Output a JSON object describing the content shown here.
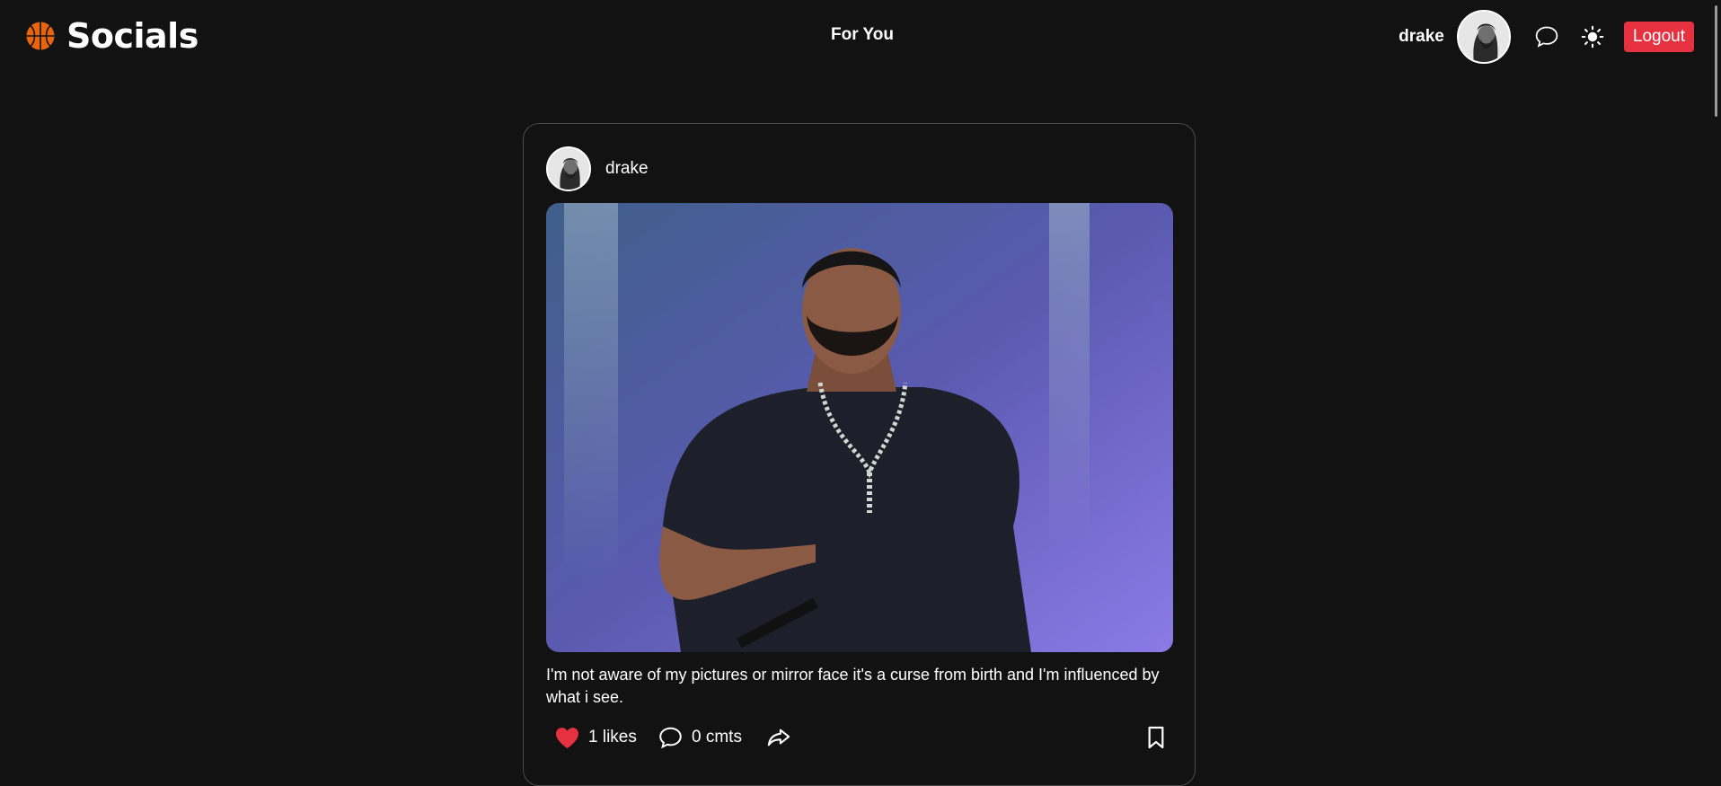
{
  "header": {
    "brand": "Socials",
    "nav_tab": "For You",
    "username": "drake",
    "logout_label": "Logout"
  },
  "post": {
    "username": "drake",
    "caption": "I'm not aware of my pictures or mirror face it's a curse from birth and I'm influenced by what i see.",
    "likes_label": "1 likes",
    "comments_label": "0 cmts"
  },
  "colors": {
    "background": "#121212",
    "logout": "#e63240",
    "like_heart": "#e63240",
    "brand_icon": "#e8650f"
  },
  "icons": [
    "basketball-icon",
    "chat-icon",
    "sun-icon",
    "heart-icon",
    "comment-icon",
    "share-icon",
    "bookmark-icon"
  ]
}
